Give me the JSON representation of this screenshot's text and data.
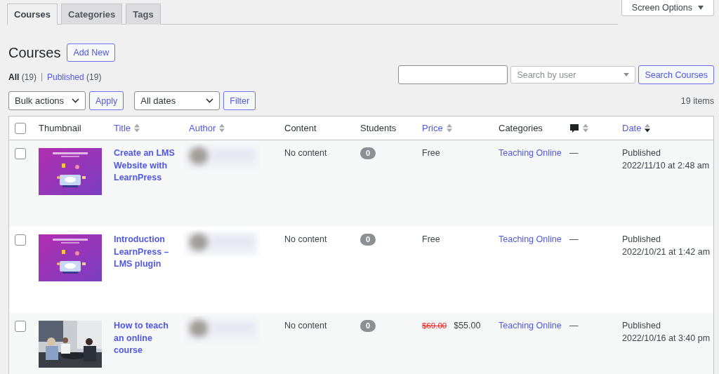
{
  "tabs": [
    {
      "label": "Courses",
      "selected": true
    },
    {
      "label": "Categories",
      "selected": false
    },
    {
      "label": "Tags",
      "selected": false
    }
  ],
  "screen_options": {
    "label": "Screen Options",
    "expanded": false
  },
  "heading": {
    "title": "Courses",
    "action": "Add New"
  },
  "views": [
    {
      "label": "All",
      "count": "(19)",
      "selected": true
    },
    {
      "label": "Published",
      "count": "(19)",
      "selected": false
    }
  ],
  "search": {
    "user_select": {
      "placeholder": "Search by user"
    },
    "button": "Search Courses"
  },
  "bulk": {
    "select": "Bulk actions",
    "apply": "Apply",
    "dates": "All dates",
    "filter": "Filter"
  },
  "count": "19 items",
  "table": {
    "select_all": {
      "checked": false
    },
    "columns": [
      {
        "kind": "text",
        "label": "Thumbnail",
        "sortable": false
      },
      {
        "kind": "text",
        "label": "Title",
        "sortable": true,
        "sorted": false
      },
      {
        "kind": "text",
        "label": "Author",
        "sortable": true,
        "sorted": false
      },
      {
        "kind": "text",
        "label": "Content",
        "sortable": false
      },
      {
        "kind": "text",
        "label": "Students",
        "sortable": false
      },
      {
        "kind": "text",
        "label": "Price",
        "sortable": true,
        "sorted": false
      },
      {
        "kind": "text",
        "label": "Categories",
        "sortable": false
      },
      {
        "kind": "comments",
        "sortable": true,
        "sorted": false
      },
      {
        "kind": "text",
        "label": "Date",
        "sortable": true,
        "sorted": true
      }
    ],
    "rows": [
      {
        "checked": false,
        "title": "Create an LMS Website with LearnPress",
        "author": {
          "kind": "blurred"
        },
        "content": "No content",
        "students": "0",
        "price_original": null,
        "price": "Free",
        "category": "Teaching Online",
        "comments": "—",
        "status": "Published",
        "date": "2022/11/10 at 2:48 am"
      },
      {
        "checked": false,
        "title": "Introduction LearnPress – LMS plugin",
        "author": {
          "kind": "blurred"
        },
        "content": "No content",
        "students": "0",
        "price_original": null,
        "price": "Free",
        "category": "Teaching Online",
        "comments": "—",
        "status": "Published",
        "date": "2022/10/21 at 1:42 am"
      },
      {
        "checked": false,
        "title": "How to teach an online course",
        "author": {
          "kind": "blurred"
        },
        "content": "No content",
        "students": "0",
        "price_original": "$69.00",
        "price": "$55.00",
        "category": "Teaching Online",
        "comments": "—",
        "status": "Published",
        "date": "2022/10/16 at 3:40 pm"
      }
    ]
  }
}
